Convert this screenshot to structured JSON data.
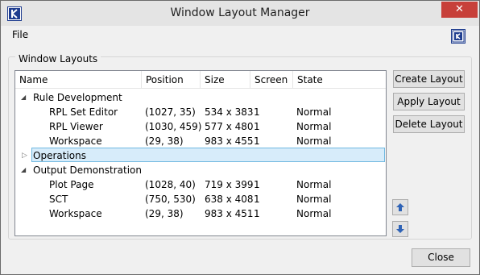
{
  "window": {
    "title": "Window Layout Manager",
    "close_glyph": "✕"
  },
  "menu": {
    "file": "File"
  },
  "group": {
    "legend": "Window Layouts"
  },
  "columns": [
    "Name",
    "Position",
    "Size",
    "Screen",
    "State"
  ],
  "groups": [
    {
      "name": "Rule Development",
      "expanded": true,
      "rows": [
        {
          "name": "RPL Set Editor",
          "position": "(1027, 35)",
          "size": "534 x 383",
          "screen": "1",
          "state": "Normal"
        },
        {
          "name": "RPL Viewer",
          "position": "(1030, 459)",
          "size": "577 x 480",
          "screen": "1",
          "state": "Normal"
        },
        {
          "name": "Workspace",
          "position": "(29, 38)",
          "size": "983 x 455",
          "screen": "1",
          "state": "Normal"
        }
      ]
    },
    {
      "name": "Operations",
      "expanded": false,
      "rows": []
    },
    {
      "name": "Output Demonstration",
      "expanded": true,
      "rows": [
        {
          "name": "Plot Page",
          "position": "(1028, 40)",
          "size": "719 x 399",
          "screen": "1",
          "state": "Normal"
        },
        {
          "name": "SCT",
          "position": "(750, 530)",
          "size": "638 x 408",
          "screen": "1",
          "state": "Normal"
        },
        {
          "name": "Workspace",
          "position": "(29, 38)",
          "size": "983 x 451",
          "screen": "1",
          "state": "Normal"
        }
      ]
    }
  ],
  "buttons": {
    "create": "Create Layout",
    "apply": "Apply Layout",
    "delete": "Delete Layout",
    "close": "Close"
  },
  "icons": {
    "app": "app-logo-icon",
    "menu_right": "window-app-icon",
    "move_up": "arrow-up-icon",
    "move_down": "arrow-down-icon",
    "expanded": "expanded-triangle-icon",
    "collapsed": "collapsed-triangle-icon"
  },
  "colors": {
    "selected_row": "#d7ecfa",
    "selected_border": "#6fb8e0",
    "arrow_blue": "#2f63b6"
  }
}
